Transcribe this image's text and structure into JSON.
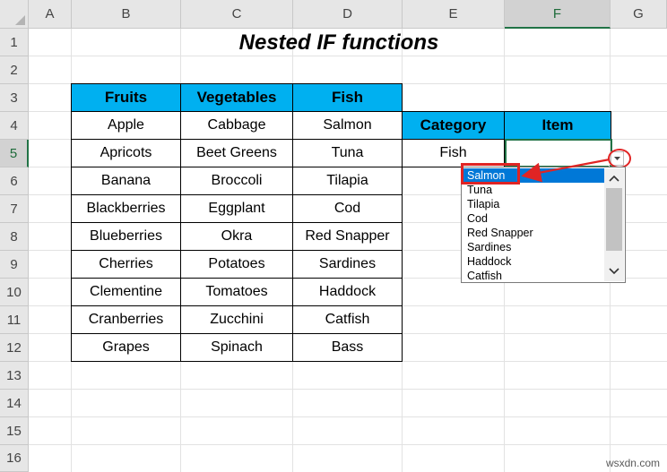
{
  "columns": [
    "A",
    "B",
    "C",
    "D",
    "E",
    "F",
    "G"
  ],
  "rows": [
    "1",
    "2",
    "3",
    "4",
    "5",
    "6",
    "7",
    "8",
    "9",
    "10",
    "11",
    "12",
    "13",
    "14",
    "15",
    "16"
  ],
  "selected_column": "F",
  "selected_row": "5",
  "title": "Nested IF functions",
  "table": {
    "headers": [
      "Fruits",
      "Vegetables",
      "Fish"
    ],
    "rows": [
      [
        "Apple",
        "Cabbage",
        "Salmon"
      ],
      [
        "Apricots",
        "Beet Greens",
        "Tuna"
      ],
      [
        "Banana",
        "Broccoli",
        "Tilapia"
      ],
      [
        "Blackberries",
        "Eggplant",
        "Cod"
      ],
      [
        "Blueberries",
        "Okra",
        "Red Snapper"
      ],
      [
        "Cherries",
        "Potatoes",
        "Sardines"
      ],
      [
        "Clementine",
        "Tomatoes",
        "Haddock"
      ],
      [
        "Cranberries",
        "Zucchini",
        "Catfish"
      ],
      [
        "Grapes",
        "Spinach",
        "Bass"
      ]
    ]
  },
  "lookup": {
    "headers": [
      "Category",
      "Item"
    ],
    "category_value": "Fish",
    "item_value": ""
  },
  "dropdown": {
    "items": [
      "Salmon",
      "Tuna",
      "Tilapia",
      "Cod",
      "Red Snapper",
      "Sardines",
      "Haddock",
      "Catfish"
    ],
    "selected": "Salmon",
    "arrow_icon": "triangle-down-icon",
    "scroll_up_icon": "chevron-up-icon",
    "scroll_down_icon": "chevron-down-icon"
  },
  "colors": {
    "header_fill": "#00b0f0",
    "selection_green": "#217346",
    "highlight_red": "#e02424",
    "dropdown_selected": "#0078d7"
  },
  "watermark": "wsxdn.com"
}
